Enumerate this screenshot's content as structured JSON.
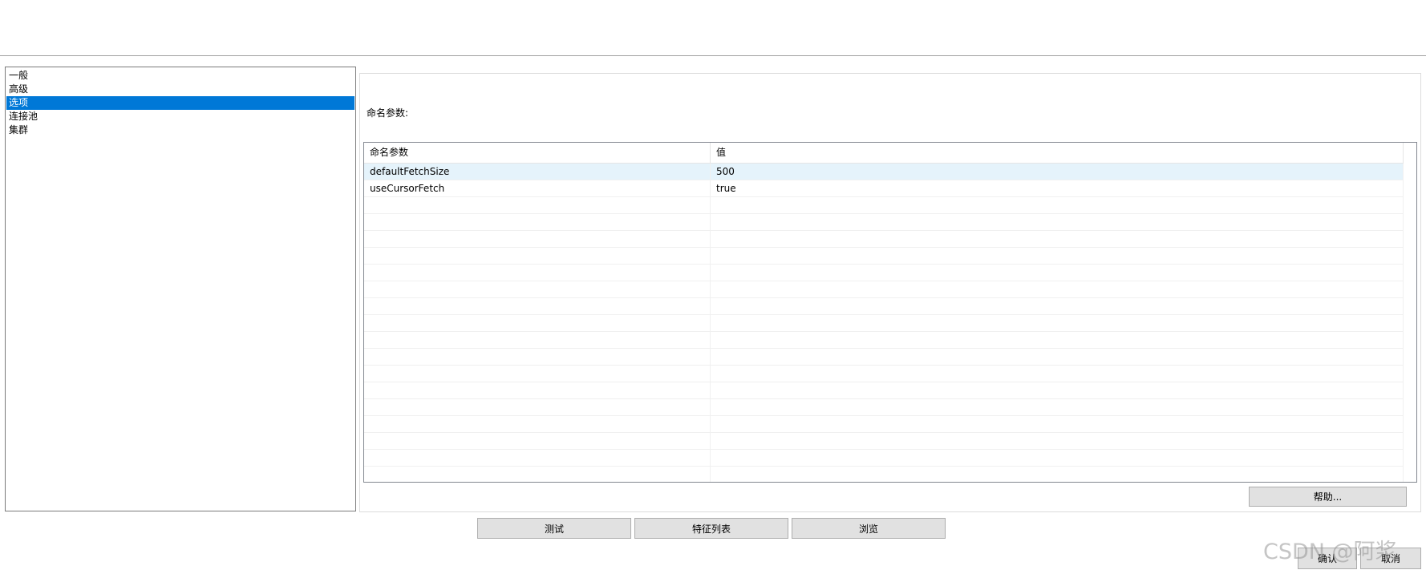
{
  "nav": {
    "items": [
      {
        "label": "一般"
      },
      {
        "label": "高级"
      },
      {
        "label": "选项"
      },
      {
        "label": "连接池"
      },
      {
        "label": "集群"
      }
    ],
    "selected_index": 2
  },
  "options": {
    "section_label": "命名参数:",
    "table": {
      "headers": [
        "命名参数",
        "值"
      ],
      "rows": [
        [
          "defaultFetchSize",
          "500"
        ],
        [
          "useCursorFetch",
          "true"
        ]
      ],
      "empty_row_count": 17
    },
    "help_label": "帮助..."
  },
  "actions": {
    "test_label": "测试",
    "feature_list_label": "特征列表",
    "browse_label": "浏览"
  },
  "dialog": {
    "ok_label": "确认",
    "cancel_label": "取消"
  },
  "watermark": "CSDN @阿浆",
  "colors": {
    "selection": "#0078d7",
    "row_highlight": "#e5f3fb",
    "button_face": "#e1e1e1"
  }
}
